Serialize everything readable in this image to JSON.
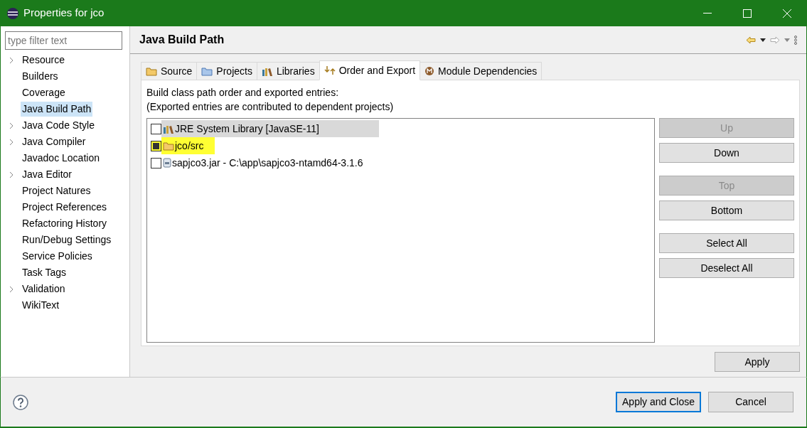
{
  "window": {
    "title": "Properties for jco"
  },
  "filter": {
    "placeholder": "type filter text"
  },
  "sidebar": {
    "items": [
      {
        "label": "Resource",
        "expandable": true,
        "selected": false
      },
      {
        "label": "Builders",
        "expandable": false,
        "selected": false
      },
      {
        "label": "Coverage",
        "expandable": false,
        "selected": false
      },
      {
        "label": "Java Build Path",
        "expandable": false,
        "selected": true
      },
      {
        "label": "Java Code Style",
        "expandable": true,
        "selected": false
      },
      {
        "label": "Java Compiler",
        "expandable": true,
        "selected": false
      },
      {
        "label": "Javadoc Location",
        "expandable": false,
        "selected": false
      },
      {
        "label": "Java Editor",
        "expandable": true,
        "selected": false
      },
      {
        "label": "Project Natures",
        "expandable": false,
        "selected": false
      },
      {
        "label": "Project References",
        "expandable": false,
        "selected": false
      },
      {
        "label": "Refactoring History",
        "expandable": false,
        "selected": false
      },
      {
        "label": "Run/Debug Settings",
        "expandable": false,
        "selected": false
      },
      {
        "label": "Service Policies",
        "expandable": false,
        "selected": false
      },
      {
        "label": "Task Tags",
        "expandable": false,
        "selected": false
      },
      {
        "label": "Validation",
        "expandable": true,
        "selected": false
      },
      {
        "label": "WikiText",
        "expandable": false,
        "selected": false
      }
    ]
  },
  "page": {
    "title": "Java Build Path"
  },
  "tabs": [
    {
      "label": "Source",
      "kind": "source",
      "selected": false
    },
    {
      "label": "Projects",
      "kind": "projects",
      "selected": false
    },
    {
      "label": "Libraries",
      "kind": "libraries",
      "selected": false
    },
    {
      "label": "Order and Export",
      "kind": "order",
      "selected": true
    },
    {
      "label": "Module Dependencies",
      "kind": "module",
      "selected": false
    }
  ],
  "description": [
    "Build class path order and exported entries:",
    "(Exported entries are contributed to dependent projects)"
  ],
  "entries": [
    {
      "label": "JRE System Library [JavaSE-11]",
      "kind": "library",
      "checked": false,
      "selected": true,
      "highlighted": false
    },
    {
      "label": "jco/src",
      "kind": "source",
      "checked": true,
      "selected": false,
      "highlighted": true
    },
    {
      "label": "sapjco3.jar - C:\\app\\sapjco3-ntamd64-3.1.6",
      "kind": "jar",
      "checked": false,
      "selected": false,
      "highlighted": false
    }
  ],
  "side_button_groups": [
    [
      {
        "label": "Up",
        "disabled": true
      },
      {
        "label": "Down",
        "disabled": false
      }
    ],
    [
      {
        "label": "Top",
        "disabled": true
      },
      {
        "label": "Bottom",
        "disabled": false
      }
    ],
    [
      {
        "label": "Select All",
        "disabled": false
      },
      {
        "label": "Deselect All",
        "disabled": false
      }
    ]
  ],
  "apply_button": "Apply",
  "footer_buttons": [
    {
      "label": "Apply and Close",
      "default": true
    },
    {
      "label": "Cancel",
      "default": false
    }
  ]
}
